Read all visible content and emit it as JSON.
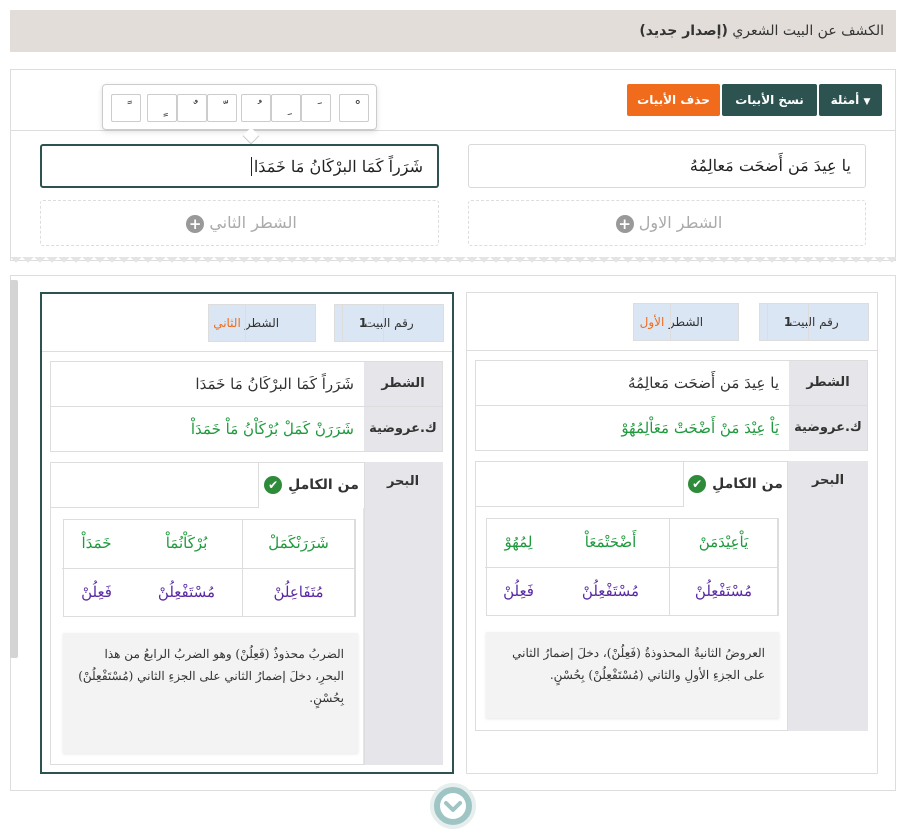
{
  "header": {
    "title": "الكشف عن البيت الشعري",
    "title_bold": "(إصدار جديد)"
  },
  "toolbar": {
    "examples": "أمثلة",
    "copy": "نسخ الأبيات",
    "delete": "حذف الأبيات"
  },
  "diacritics_keys": [
    "ْ",
    "َ",
    "ِ",
    "ُ",
    "ّ",
    "ٌ",
    "ٍ",
    "ً",
    "ّ"
  ],
  "input": {
    "first_hemistich": "يا عِيدَ مَن أَضحَت مَعالِمُهُ",
    "second_hemistich": "شَرَراً كَمَا البرْكَانُ مَا خَمَدَا",
    "add_first": "الشطر الاول",
    "add_second": "الشطر الثاني"
  },
  "panels": [
    {
      "verse_no_label": "رقم البيت",
      "verse_no": "1",
      "hemi_label": "الشطر",
      "hemi_value": "الأول",
      "row1_label": "الشطر",
      "row1_text": "يا عِيدَ مَن أَضحَت مَعالِمُهُ",
      "row2_label": "ك.عروضية",
      "row2_text": "يَاْ عِيْدَ مَنْ أَضْحَتْ مَعَاْلِمُهُوْ",
      "bahr_label": "البحر",
      "bahr_tab": "من الكاملِ",
      "tafeel_words": [
        "يَاْعِيْدَمَنْ",
        "أَضْحَتْمَعَاْ",
        "لِمُهُوْ"
      ],
      "tafeel_feet": [
        "مُسْتَفْعِلُنْ",
        "مُسْتَفْعِلُنْ",
        "فَعِلُنْ"
      ],
      "note": "العروضُ الثانيةُ المحذوذةُ (فَعِلُنْ)، دخلَ إضمارُ الثاني على الجزءِ الأولِ والثاني (مُسْتَفْعِلُنْ) بِحُسْنٍ."
    },
    {
      "verse_no_label": "رقم البيت",
      "verse_no": "1",
      "hemi_label": "الشطر",
      "hemi_value": "الثاني",
      "row1_label": "الشطر",
      "row1_text": "شَرَراً كَمَا البرْكَانُ مَا خَمَدَا",
      "row2_label": "ك.عروضية",
      "row2_text": "شَرَرَنْ كَمَلْ بُرْكَاْنُ مَاْ خَمَدَاْ",
      "bahr_label": "البحر",
      "bahr_tab": "من الكاملِ",
      "tafeel_words": [
        "شَرَرَنْكَمَلْ",
        "بُرْكَاْنُمَاْ",
        "خَمَدَاْ"
      ],
      "tafeel_feet": [
        "مُتَفَاعِلُنْ",
        "مُسْتَفْعِلُنْ",
        "فَعِلُنْ"
      ],
      "note": "الضربُ محذوذٌ (فَعِلُنْ) وهو الضربُ الرابعُ من هذا البحرِ، دخلَ إضمارُ الثاني على الجزءِ الثاني (مُسْتَفْعِلُنْ) بِحُسْنٍ."
    }
  ]
}
